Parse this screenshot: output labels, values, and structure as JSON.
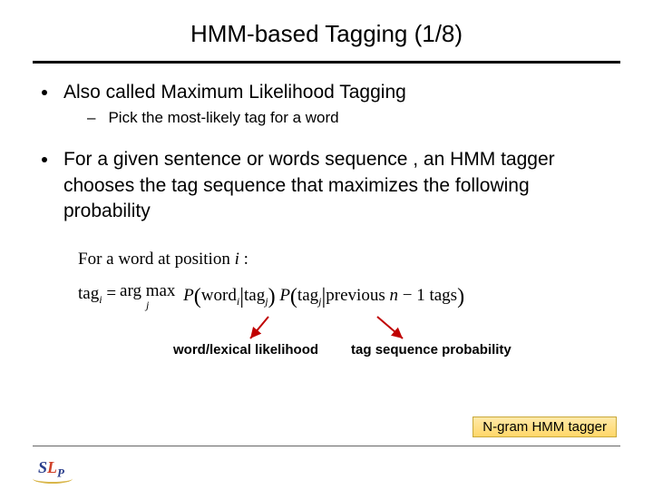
{
  "title": "HMM-based Tagging (1/8)",
  "bullets": {
    "b1_prefix": "Also called ",
    "b1_emph": "Maximum Likelihood Tagging",
    "b1_sub": "Pick the most-likely tag for a word",
    "b2": "For a given sentence or words sequence , an HMM tagger chooses the tag sequence that maximizes the following probability"
  },
  "equation": {
    "intro": "For a word at position",
    "intro_var": "i",
    "intro_colon": ":",
    "lhs_pre": "tag",
    "lhs_sub": "i",
    "eq": " = ",
    "argmax_top": "arg max",
    "argmax_bot": "j",
    "p1_P": "P",
    "p1_word": "word",
    "p1_wsub": "i",
    "p1_bar": "tag",
    "p1_tsub": "j",
    "p2_P": "P",
    "p2_tag": "tag",
    "p2_tsub": "j",
    "p2_prev_a": "previous ",
    "p2_prev_n": "n",
    "p2_prev_b": " − 1 tags"
  },
  "labels": {
    "lexical": "word/lexical likelihood",
    "tagseq": "tag sequence probability"
  },
  "box": "N-gram HMM tagger",
  "logo": {
    "a": "S",
    "b": "L",
    "c": "P"
  }
}
